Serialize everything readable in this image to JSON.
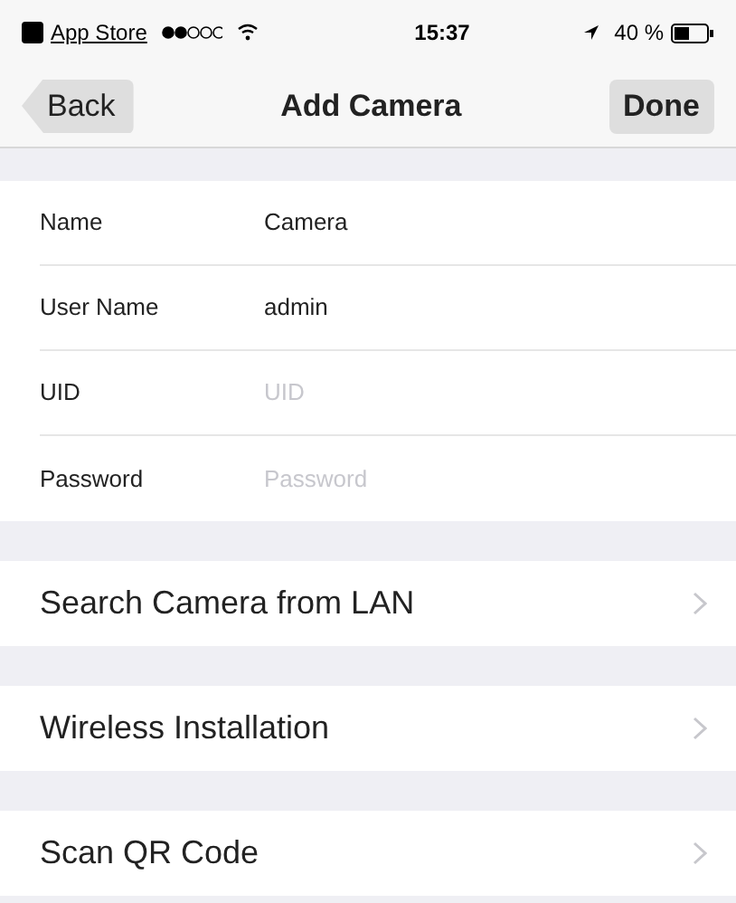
{
  "status_bar": {
    "back_app": "App Store",
    "time": "15:37",
    "battery": "40 %"
  },
  "nav": {
    "back": "Back",
    "title": "Add Camera",
    "done": "Done"
  },
  "fields": [
    {
      "label": "Name",
      "value": "Camera"
    },
    {
      "label": "User Name",
      "value": "admin"
    },
    {
      "label": "UID",
      "placeholder": "UID"
    },
    {
      "label": "Password",
      "placeholder": "Password"
    }
  ],
  "actions": [
    {
      "label": "Search Camera from LAN"
    },
    {
      "label": "Wireless Installation"
    },
    {
      "label": "Scan QR Code"
    }
  ]
}
